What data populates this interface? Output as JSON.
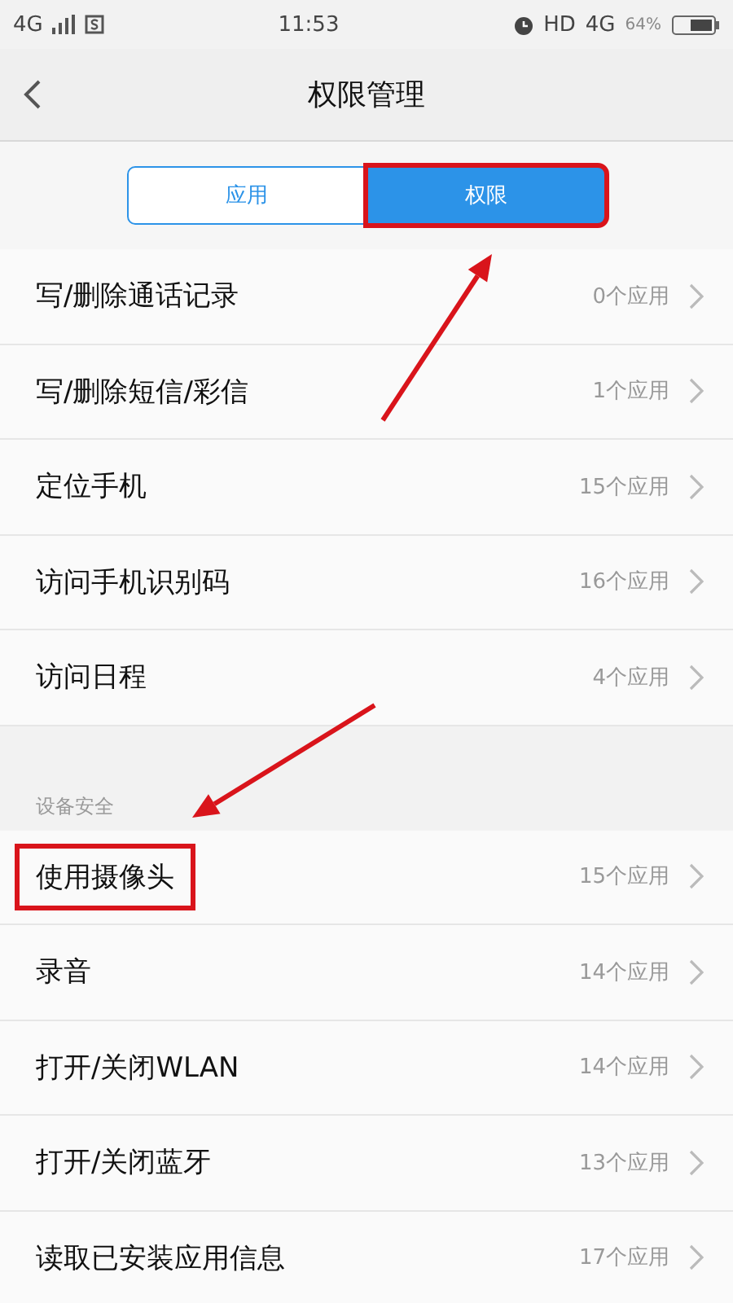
{
  "status_bar": {
    "network": "4G",
    "time": "11:53",
    "hd": "HD",
    "network_right": "4G",
    "battery": "64%"
  },
  "header": {
    "title": "权限管理"
  },
  "tabs": [
    {
      "label": "应用",
      "selected": false,
      "highlighted": false
    },
    {
      "label": "权限",
      "selected": true,
      "highlighted": true
    }
  ],
  "sections": [
    {
      "rows": [
        {
          "label": "写/删除通话记录",
          "count": "0个应用",
          "highlighted": false
        },
        {
          "label": "写/删除短信/彩信",
          "count": "1个应用",
          "highlighted": false
        },
        {
          "label": "定位手机",
          "count": "15个应用",
          "highlighted": false
        },
        {
          "label": "访问手机识别码",
          "count": "16个应用",
          "highlighted": false
        },
        {
          "label": "访问日程",
          "count": "4个应用",
          "highlighted": false
        }
      ]
    },
    {
      "title": "设备安全",
      "rows": [
        {
          "label": "使用摄像头",
          "count": "15个应用",
          "highlighted": true
        },
        {
          "label": "录音",
          "count": "14个应用",
          "highlighted": false
        },
        {
          "label": "打开/关闭WLAN",
          "count": "14个应用",
          "highlighted": false
        },
        {
          "label": "打开/关闭蓝牙",
          "count": "13个应用",
          "highlighted": false
        },
        {
          "label": "读取已安装应用信息",
          "count": "17个应用",
          "highlighted": false
        }
      ]
    }
  ]
}
